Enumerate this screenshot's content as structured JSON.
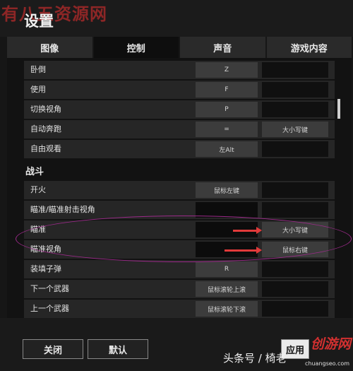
{
  "watermark": "有八五资源网",
  "title": "设置",
  "tabs": [
    "图像",
    "控制",
    "声音",
    "游戏内容"
  ],
  "active_tab": "控制",
  "rows_top": [
    {
      "label": "卧倒",
      "key1": "Z",
      "key2": ""
    },
    {
      "label": "使用",
      "key1": "F",
      "key2": ""
    },
    {
      "label": "切换视角",
      "key1": "P",
      "key2": ""
    },
    {
      "label": "自动奔跑",
      "key1": "=",
      "key2": "大小写键"
    },
    {
      "label": "自由观看",
      "key1": "左Alt",
      "key2": ""
    }
  ],
  "section_combat": "战斗",
  "rows_combat": [
    {
      "label": "开火",
      "key1": "鼠标左键",
      "key2": ""
    },
    {
      "label": "瞄准/瞄准射击视角",
      "key1": "",
      "key2": ""
    },
    {
      "label": "瞄准",
      "key1": "",
      "key2": "大小写键"
    },
    {
      "label": "瞄准视角",
      "key1": "",
      "key2": "鼠标右键"
    },
    {
      "label": "装填子弹",
      "key1": "R",
      "key2": ""
    },
    {
      "label": "下一个武器",
      "key1": "鼠标滚轮上滚",
      "key2": ""
    },
    {
      "label": "上一个武器",
      "key1": "鼠标滚轮下滚",
      "key2": ""
    }
  ],
  "buttons": {
    "close": "关闭",
    "default": "默认",
    "apply": "应用"
  },
  "credit": "头条号 / 椅老",
  "logo": {
    "text": "创游网",
    "url": "chuangseo.com"
  }
}
